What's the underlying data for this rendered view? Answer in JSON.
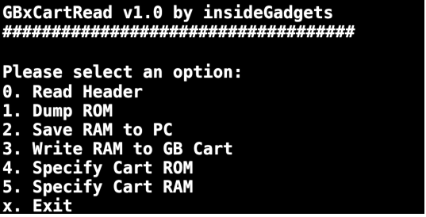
{
  "console": {
    "title": "GBxCartRead v1.0 by insideGadgets",
    "rule": "####################################",
    "prompt": "Please select an option:",
    "options": [
      "0. Read Header",
      "1. Dump ROM",
      "2. Save RAM to PC",
      "3. Write RAM to GB Cart",
      "4. Specify Cart ROM",
      "5. Specify Cart RAM",
      "x. Exit"
    ]
  },
  "colors": {
    "background": "#000000",
    "text": "#ffffff"
  }
}
